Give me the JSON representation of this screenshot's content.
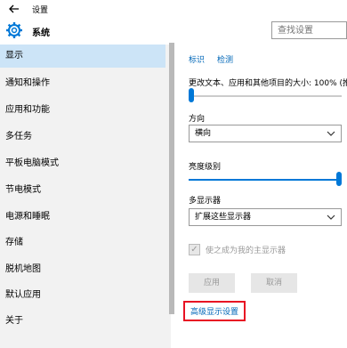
{
  "window": {
    "title": "设置",
    "back_icon": "back-arrow-icon"
  },
  "header": {
    "title": "系统",
    "icon": "gear-icon",
    "search_placeholder": "查找设置"
  },
  "colors": {
    "accent": "#0078d7",
    "sidebar_bg": "#f2f2f2",
    "active_bg": "#cce4f7",
    "highlight_border": "#e81123"
  },
  "sidebar": {
    "items": [
      {
        "label": "显示",
        "active": true
      },
      {
        "label": "通知和操作"
      },
      {
        "label": "应用和功能"
      },
      {
        "label": "多任务"
      },
      {
        "label": "平板电脑模式"
      },
      {
        "label": "节电模式"
      },
      {
        "label": "电源和睡眠"
      },
      {
        "label": "存储"
      },
      {
        "label": "脱机地图"
      },
      {
        "label": "默认应用"
      },
      {
        "label": "关于"
      }
    ]
  },
  "main": {
    "identify_link": "标识",
    "detect_link": "检测",
    "scale_label": "更改文本、应用和其他项目的大小: 100% (推",
    "scale_value": 0,
    "orientation_label": "方向",
    "orientation_value": "横向",
    "brightness_label": "亮度级别",
    "brightness_value": 100,
    "multi_display_label": "多显示器",
    "multi_display_value": "扩展这些显示器",
    "main_display_checkbox_label": "使之成为我的主显示器",
    "apply_button": "应用",
    "cancel_button": "取消",
    "advanced_link": "高级显示设置"
  }
}
